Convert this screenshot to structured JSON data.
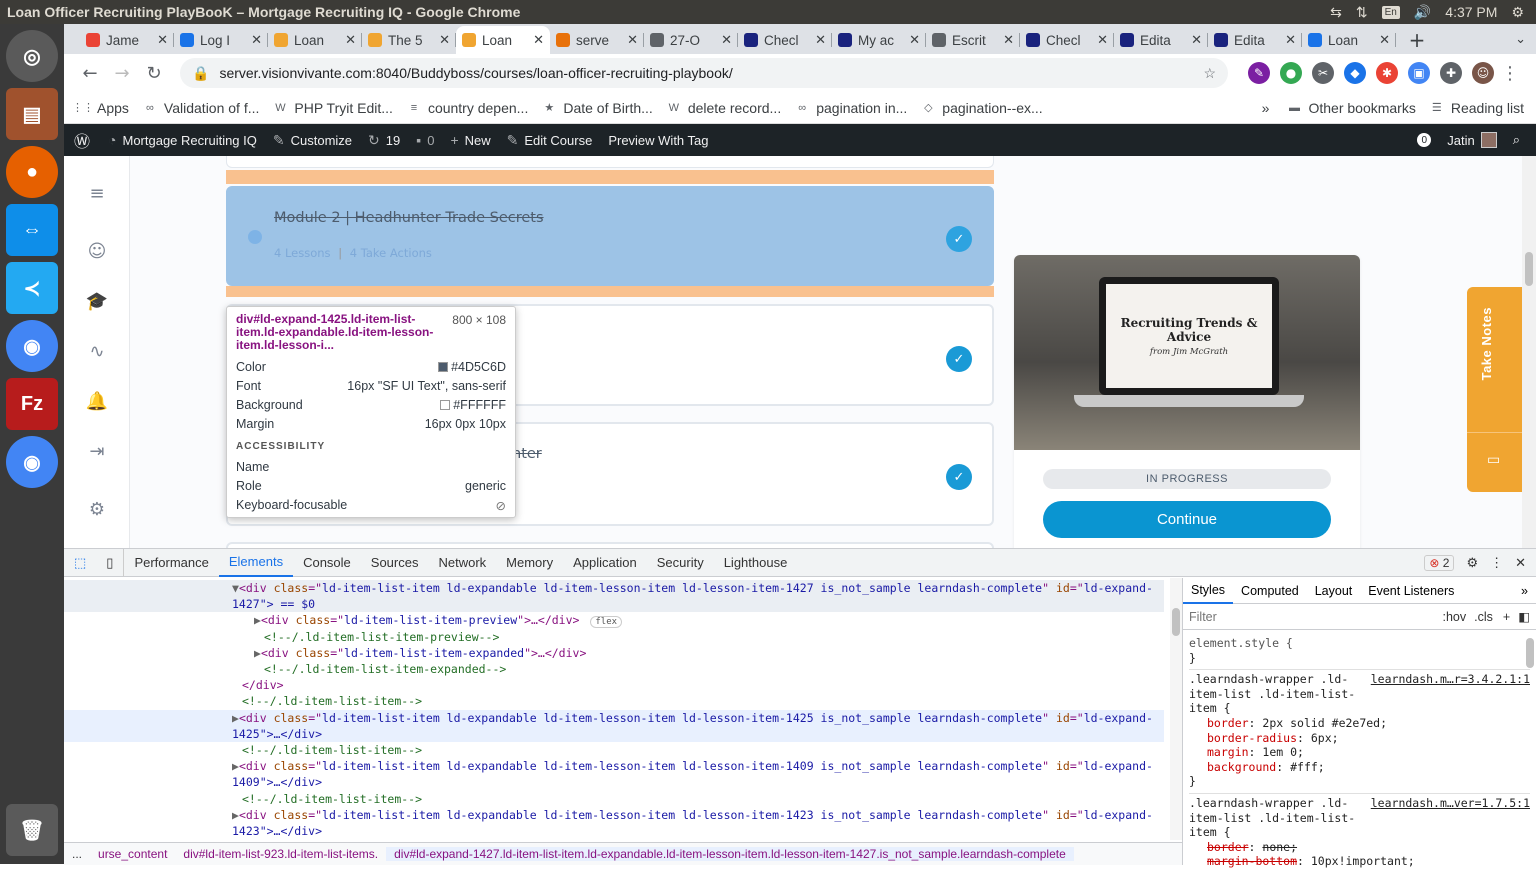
{
  "os": {
    "window_title": "Loan Officer Recruiting PlayBooK – Mortgage Recruiting IQ - Google Chrome",
    "lang": "En",
    "time": "4:37 PM"
  },
  "tabs": [
    {
      "label": "Jame",
      "color": "#ea4335"
    },
    {
      "label": "Log I",
      "color": "#1a73e8"
    },
    {
      "label": "Loan",
      "color": "#f0a531"
    },
    {
      "label": "The 5",
      "color": "#f0a531"
    },
    {
      "label": "Loan",
      "color": "#f0a531"
    },
    {
      "label": "serve",
      "color": "#e8710a"
    },
    {
      "label": "27-O",
      "color": "#5f6368"
    },
    {
      "label": "Checl",
      "color": "#1a237e"
    },
    {
      "label": "My ac",
      "color": "#1a237e"
    },
    {
      "label": "Escrit",
      "color": "#5f6368"
    },
    {
      "label": "Checl",
      "color": "#1a237e"
    },
    {
      "label": "Edita",
      "color": "#1a237e"
    },
    {
      "label": "Edita",
      "color": "#1a237e"
    },
    {
      "label": "Loan",
      "color": "#1a73e8"
    }
  ],
  "omnibox": {
    "url": "server.visionvivante.com:8040/Buddyboss/courses/loan-officer-recruiting-playbook/"
  },
  "bookmarks": [
    {
      "label": "Apps"
    },
    {
      "label": "Validation of f..."
    },
    {
      "label": "PHP Tryit Edit..."
    },
    {
      "label": "country depen..."
    },
    {
      "label": "Date of Birth..."
    },
    {
      "label": "delete record..."
    },
    {
      "label": "pagination in..."
    },
    {
      "label": "pagination--ex..."
    }
  ],
  "bookmarks_extra": {
    "more": "»",
    "other": "Other bookmarks",
    "reading": "Reading list"
  },
  "wpbar": {
    "site": "Mortgage Recruiting IQ",
    "customize": "Customize",
    "updates": "19",
    "comments": "0",
    "new": "New",
    "edit": "Edit Course",
    "preview": "Preview With Tag",
    "notif": "0",
    "user": "Jatin"
  },
  "course": {
    "module2_title": "Module 2 | Headhunter Trade Secrets",
    "module2_lessons": "4 Lessons",
    "module2_sep": "|",
    "module2_actions": "4 Take Actions",
    "module4_partial": "nter"
  },
  "tooltip": {
    "selector": "div#ld-expand-1425.ld-item-list-item.ld-expandable.ld-item-lesson-item.ld-lesson-i...",
    "size": "800 × 108",
    "color_label": "Color",
    "color_value": "#4D5C6D",
    "font_label": "Font",
    "font_value": "16px \"SF UI Text\", sans-serif",
    "bg_label": "Background",
    "bg_value": "#FFFFFF",
    "margin_label": "Margin",
    "margin_value": "16px 0px 10px",
    "accessibility": "ACCESSIBILITY",
    "name_label": "Name",
    "role_label": "Role",
    "role_value": "generic",
    "kb_label": "Keyboard-focusable"
  },
  "card": {
    "screen_title": "Recruiting Trends & Advice",
    "screen_sub": "from Jim McGrath",
    "status": "IN PROGRESS",
    "continue": "Continue"
  },
  "notes": {
    "label": "Take Notes"
  },
  "devtools": {
    "tabs": [
      "Performance",
      "Elements",
      "Console",
      "Sources",
      "Network",
      "Memory",
      "Application",
      "Security",
      "Lighthouse"
    ],
    "active_tab": "Elements",
    "error_count": "2",
    "style_tabs": [
      "Styles",
      "Computed",
      "Layout",
      "Event Listeners"
    ],
    "filter_placeholder": "Filter",
    "hov": ":hov",
    "cls": ".cls",
    "crumbs": [
      "...",
      "urse_content",
      "div#ld-item-list-923.ld-item-list-items.",
      "div#ld-expand-1427.ld-item-list-item.ld-expandable.ld-item-lesson-item.ld-lesson-item-1427.is_not_sample.learndash-complete"
    ],
    "dom": [
      {
        "indent": 0,
        "open": true,
        "kind": "open",
        "cls": "ld-item-list-item ld-expandable ld-item-lesson-item ld-lesson-item-1427 is_not_sample learndash-complete",
        "id": "ld-expand-",
        "sel": true
      },
      {
        "indent": 0,
        "kind": "cont",
        "text": "1427\"> == $0",
        "sel": true
      },
      {
        "indent": 1,
        "kind": "child",
        "cls": "ld-item-list-item-preview",
        "badge": "flex"
      },
      {
        "indent": 1,
        "kind": "comment",
        "text": "<!--/.ld-item-list-item-preview-->"
      },
      {
        "indent": 1,
        "kind": "child",
        "cls": "ld-item-list-item-expanded"
      },
      {
        "indent": 1,
        "kind": "comment",
        "text": "<!--/.ld-item-list-item-expanded-->"
      },
      {
        "indent": 0,
        "kind": "close",
        "text": "</div>"
      },
      {
        "indent": 0,
        "kind": "comment",
        "text": "<!--/.ld-item-list-item-->"
      },
      {
        "indent": 0,
        "kind": "open",
        "cls": "ld-item-list-item ld-expandable ld-item-lesson-item ld-lesson-item-1425 is_not_sample learndash-complete",
        "id": "ld-expand-",
        "hov": true
      },
      {
        "indent": 0,
        "kind": "cont",
        "text": "1425\">…</div>",
        "hov": true
      },
      {
        "indent": 0,
        "kind": "comment",
        "text": "<!--/.ld-item-list-item-->"
      },
      {
        "indent": 0,
        "kind": "open",
        "cls": "ld-item-list-item ld-expandable ld-item-lesson-item ld-lesson-item-1409 is_not_sample learndash-complete",
        "id": "ld-expand-"
      },
      {
        "indent": 0,
        "kind": "cont",
        "text": "1409\">…</div>"
      },
      {
        "indent": 0,
        "kind": "comment",
        "text": "<!--/.ld-item-list-item-->"
      },
      {
        "indent": 0,
        "kind": "open",
        "cls": "ld-item-list-item ld-expandable ld-item-lesson-item ld-lesson-item-1423 is_not_sample learndash-complete",
        "id": "ld-expand-"
      },
      {
        "indent": 0,
        "kind": "cont",
        "text": "1423\">…</div>"
      }
    ],
    "styles": {
      "element_style": "element.style {",
      "rule1_selector": ".learndash-wrapper .ld-item-list .ld-item-list-item {",
      "rule1_source": "learndash.m…r=3.4.2.1:1",
      "rule1_props": [
        {
          "name": "border",
          "value": "2px solid #e2e7ed;"
        },
        {
          "name": "border-radius",
          "value": "6px;"
        },
        {
          "name": "margin",
          "value": "1em 0;"
        },
        {
          "name": "background",
          "value": "#fff;"
        }
      ],
      "rule2_selector": ".learndash-wrapper .ld-item-list .ld-item-list-item {",
      "rule2_source": "learndash.m…ver=1.7.5:1",
      "rule2_props": [
        {
          "name": "border",
          "value": "none;"
        },
        {
          "name": "margin-bottom",
          "value": "10px!important;"
        }
      ]
    }
  }
}
